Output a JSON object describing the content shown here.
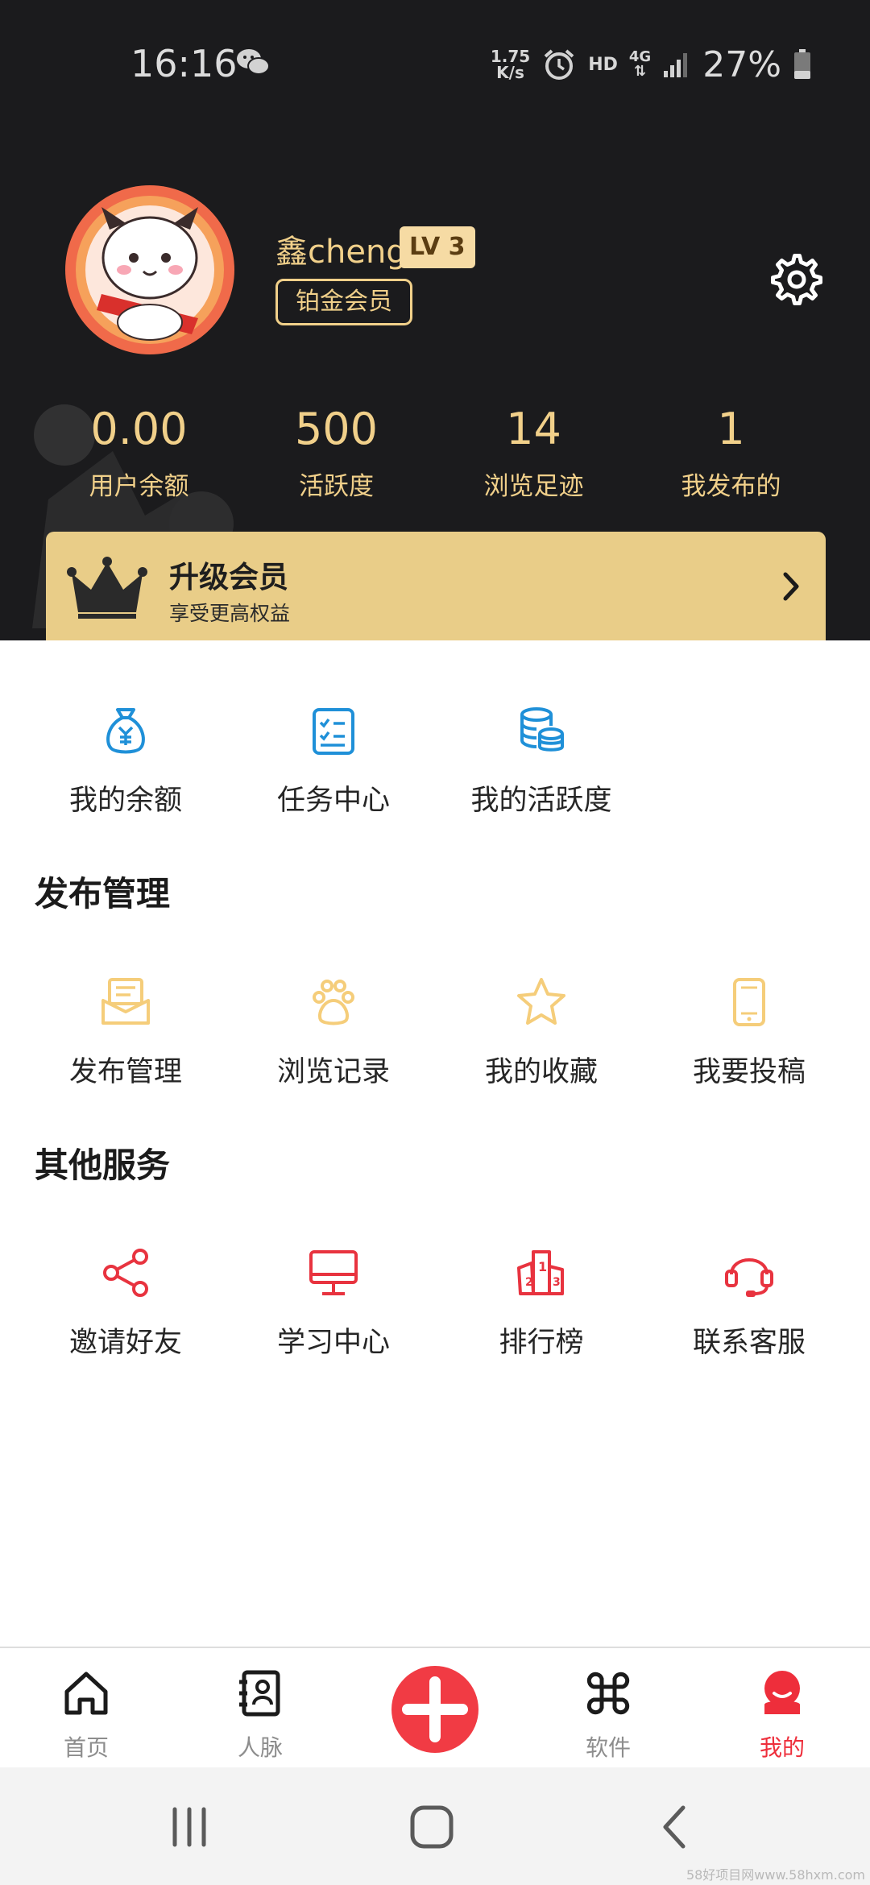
{
  "status_bar": {
    "time": "16:16",
    "net_speed_value": "1.75",
    "net_speed_unit": "K/s",
    "hd": "HD",
    "network": "4G",
    "battery": "27%"
  },
  "profile": {
    "username": "鑫cheng",
    "level": "LV 3",
    "member_tag": "铂金会员"
  },
  "stats": [
    {
      "value": "0.00",
      "label": "用户余额"
    },
    {
      "value": "500",
      "label": "活跃度"
    },
    {
      "value": "14",
      "label": "浏览足迹"
    },
    {
      "value": "1",
      "label": "我发布的"
    }
  ],
  "upgrade": {
    "title": "升级会员",
    "subtitle": "享受更高权益"
  },
  "top_items": [
    {
      "label": "我的余额",
      "icon": "money-bag-icon"
    },
    {
      "label": "任务中心",
      "icon": "task-list-icon"
    },
    {
      "label": "我的活跃度",
      "icon": "coins-stack-icon"
    }
  ],
  "publish_section": {
    "title": "发布管理",
    "items": [
      {
        "label": "发布管理",
        "icon": "envelope-icon"
      },
      {
        "label": "浏览记录",
        "icon": "paw-icon"
      },
      {
        "label": "我的收藏",
        "icon": "star-icon"
      },
      {
        "label": "我要投稿",
        "icon": "phone-icon"
      }
    ]
  },
  "other_section": {
    "title": "其他服务",
    "items": [
      {
        "label": "邀请好友",
        "icon": "share-icon"
      },
      {
        "label": "学习中心",
        "icon": "monitor-icon"
      },
      {
        "label": "排行榜",
        "icon": "podium-icon"
      },
      {
        "label": "联系客服",
        "icon": "headset-icon"
      }
    ]
  },
  "tabbar": [
    {
      "label": "首页",
      "icon": "home-icon",
      "active": false
    },
    {
      "label": "人脉",
      "icon": "contacts-icon",
      "active": false
    },
    {
      "label": "",
      "icon": "plus-icon",
      "active": false
    },
    {
      "label": "软件",
      "icon": "apps-icon",
      "active": false
    },
    {
      "label": "我的",
      "icon": "profile-icon",
      "active": true
    }
  ],
  "watermark": "58好项目网www.58hxm.com",
  "colors": {
    "header_bg": "#1b1b1d",
    "gold": "#f1d08a",
    "upgrade_bg": "#e9cd88",
    "blue_icons": "#1f90d8",
    "yellow_icons": "#f5cd7a",
    "red_icons": "#e8333f",
    "active_tab": "#ee2e3b"
  }
}
